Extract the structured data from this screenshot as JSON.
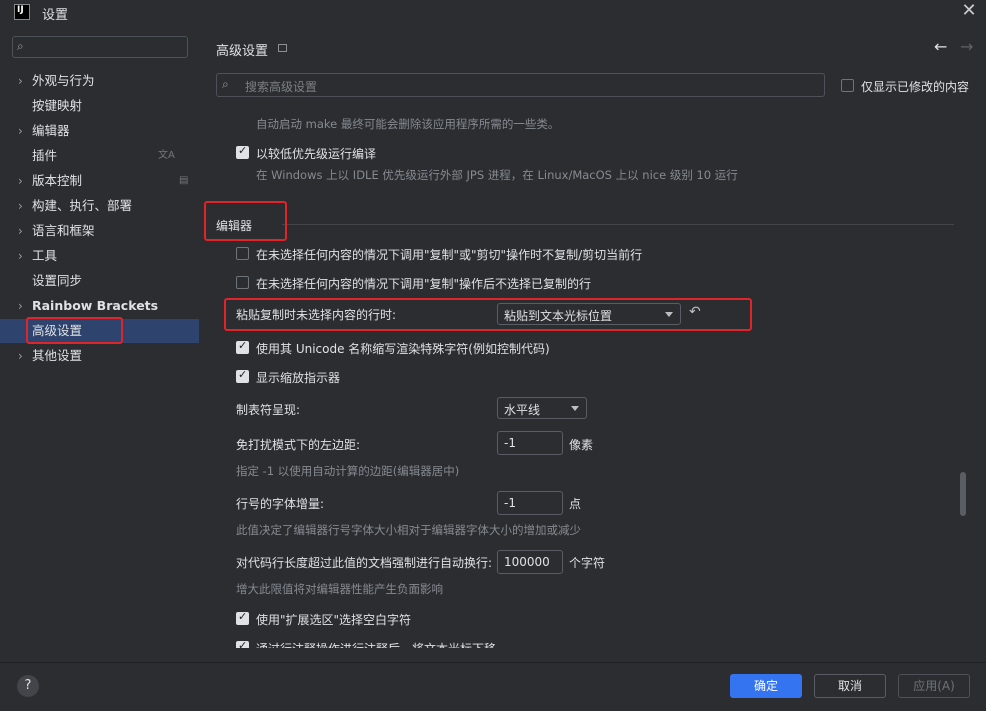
{
  "window": {
    "title": "设置",
    "app_icon_text": "IJ"
  },
  "sidebar": {
    "items": [
      {
        "label": "外观与行为",
        "expandable": true
      },
      {
        "label": "按键映射",
        "expandable": false
      },
      {
        "label": "编辑器",
        "expandable": true
      },
      {
        "label": "插件",
        "expandable": false,
        "side_icon": "translate-icon"
      },
      {
        "label": "版本控制",
        "expandable": true,
        "side_icon": "menu-icon"
      },
      {
        "label": "构建、执行、部署",
        "expandable": true
      },
      {
        "label": "语言和框架",
        "expandable": true
      },
      {
        "label": "工具",
        "expandable": true
      },
      {
        "label": "设置同步",
        "expandable": false
      },
      {
        "label": "Rainbow Brackets",
        "expandable": true
      },
      {
        "label": "高级设置",
        "expandable": false,
        "selected": true
      },
      {
        "label": "其他设置",
        "expandable": true
      }
    ]
  },
  "main": {
    "title": "高级设置",
    "search_placeholder": "搜索高级设置",
    "only_modified_label": "仅显示已修改的内容",
    "auto_make_hint": "自动启动 make 最终可能会删除该应用程序所需的一些类。",
    "low_priority_label": "以较低优先级运行编译",
    "low_priority_hint": "在 Windows 上以 IDLE 优先级运行外部 JPS 进程，在 Linux/MacOS 上以 nice 级别 10 运行",
    "section_editor": "编辑器",
    "no_copy_cut_label": "在未选择任何内容的情况下调用\"复制\"或\"剪切\"操作时不复制/剪切当前行",
    "no_select_copied_label": "在未选择任何内容的情况下调用\"复制\"操作后不选择已复制的行",
    "paste_label": "粘贴复制时未选择内容的行时:",
    "paste_value": "粘贴到文本光标位置",
    "unicode_label": "使用其 Unicode 名称缩写渲染特殊字符(例如控制代码)",
    "zoom_indicator_label": "显示缩放指示器",
    "tab_render_label": "制表符呈现:",
    "tab_render_value": "水平线",
    "distraction_margin_label": "免打扰模式下的左边距:",
    "distraction_margin_value": "-1",
    "distraction_margin_unit": "像素",
    "distraction_margin_hint": "指定 -1 以使用自动计算的边距(编辑器居中)",
    "line_number_font_label": "行号的字体增量:",
    "line_number_font_value": "-1",
    "line_number_font_unit": "点",
    "line_number_font_hint": "此值决定了编辑器行号字体大小相对于编辑器字体大小的增加或减少",
    "soft_wrap_label": "对代码行长度超过此值的文档强制进行自动换行:",
    "soft_wrap_value": "100000",
    "soft_wrap_unit": "个字符",
    "soft_wrap_hint": "增大此限值将对编辑器性能产生负面影响",
    "extend_selection_label": "使用\"扩展选区\"选择空白字符",
    "cut_off_label": "通过行注释操作进行注释后，将文本光标下移"
  },
  "footer": {
    "help": "?",
    "ok": "确定",
    "cancel": "取消",
    "apply": "应用(A)"
  },
  "colors": {
    "accent": "#3574f0",
    "selection": "#2e436e",
    "highlight_box": "#e0242a",
    "background": "#2b2d30"
  }
}
